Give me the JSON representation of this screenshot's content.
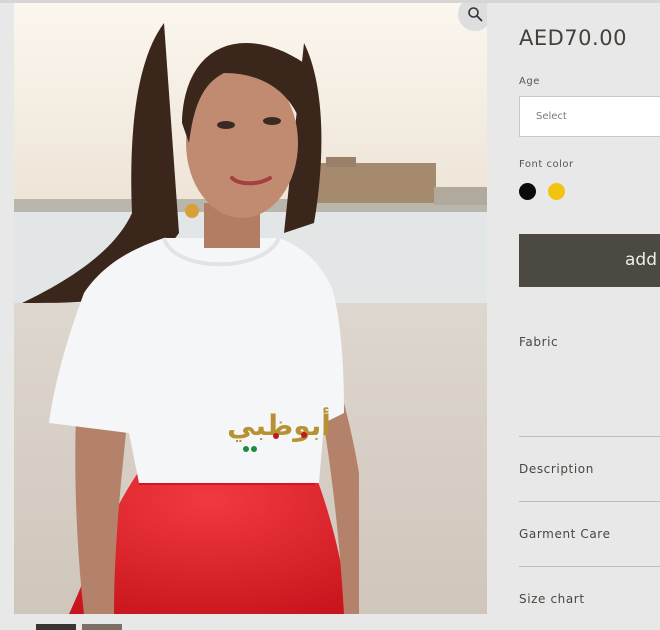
{
  "product": {
    "price": "AED70.00",
    "shirt_print": "أبوظبي"
  },
  "options": {
    "age_label": "Age",
    "age_placeholder": "Select",
    "font_color_label": "Font color",
    "font_colors": [
      "#0a0a0a",
      "#f1c40f"
    ]
  },
  "add_to_cart_label": "add",
  "accordion": [
    {
      "label": "Fabric"
    },
    {
      "label": "Description"
    },
    {
      "label": "Garment Care"
    },
    {
      "label": "Size chart"
    }
  ],
  "icons": {
    "zoom": "magnifier-icon"
  }
}
